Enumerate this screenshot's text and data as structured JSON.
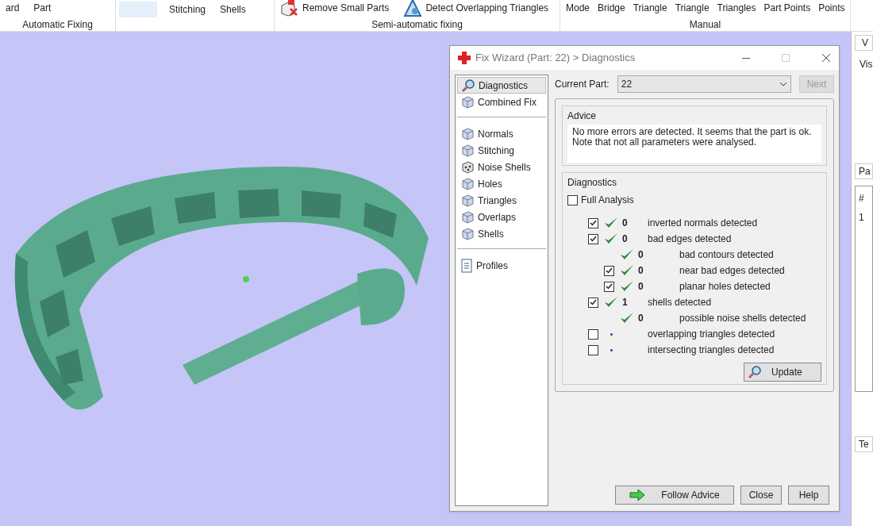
{
  "ribbon": {
    "groups": [
      {
        "label": "Automatic Fixing",
        "items": [
          {
            "text": "ard",
            "selected": false
          },
          {
            "text": "Part",
            "selected": false
          }
        ]
      },
      {
        "items": [
          {
            "selected": true
          },
          {
            "text": "Stitching",
            "selected": false
          },
          {
            "text": "Shells",
            "selected": false
          }
        ]
      },
      {
        "label": "Semi-automatic fixing",
        "items": [
          {
            "text": "Remove Small Parts",
            "selected": false
          },
          {
            "text": "Detect Overlapping Triangles",
            "selected": false
          }
        ]
      },
      {
        "label": "Manual",
        "items": [
          {
            "text": "Mode",
            "selected": false
          },
          {
            "text": "Bridge",
            "selected": false
          },
          {
            "text": "Triangle",
            "selected": false
          },
          {
            "text": "Triangle",
            "selected": false
          },
          {
            "text": "Triangles",
            "selected": false
          },
          {
            "text": "Part Points",
            "selected": false
          },
          {
            "text": "Points",
            "selected": false
          }
        ]
      }
    ]
  },
  "dialog": {
    "title": "Fix Wizard (Part: 22) > Diagnostics",
    "sidebar": {
      "groups": [
        [
          {
            "label": "Diagnostics",
            "selected": true
          },
          {
            "label": "Combined Fix",
            "selected": false
          }
        ],
        [
          {
            "label": "Normals",
            "selected": false
          },
          {
            "label": "Stitching",
            "selected": false
          },
          {
            "label": "Noise Shells",
            "selected": false
          },
          {
            "label": "Holes",
            "selected": false
          },
          {
            "label": "Triangles",
            "selected": false
          },
          {
            "label": "Overlaps",
            "selected": false
          },
          {
            "label": "Shells",
            "selected": false
          }
        ],
        [
          {
            "label": "Profiles",
            "selected": false
          }
        ]
      ]
    },
    "current_part": {
      "label": "Current Part:",
      "value": "22"
    },
    "next_button": {
      "label": "Next",
      "disabled": true
    },
    "advice": {
      "title": "Advice",
      "text": "No more errors are detected. It seems that the part is ok.\nNote that not all parameters were analysed."
    },
    "diagnostics": {
      "title": "Diagnostics",
      "full_analysis": {
        "label": "Full Analysis",
        "checked": false
      },
      "rows": [
        {
          "kind": "checkbox",
          "checked": true,
          "passed": true,
          "count": "0",
          "label": "inverted normals detected"
        },
        {
          "kind": "checkbox",
          "checked": true,
          "passed": true,
          "count": "0",
          "label": "bad edges detected",
          "children": [
            {
              "kind": "plain",
              "passed": true,
              "count": "0",
              "label": "bad contours detected"
            },
            {
              "kind": "checkbox",
              "checked": true,
              "passed": true,
              "count": "0",
              "label": "near bad edges detected"
            },
            {
              "kind": "checkbox",
              "checked": true,
              "passed": true,
              "count": "0",
              "label": "planar holes detected"
            }
          ]
        },
        {
          "kind": "checkbox",
          "checked": true,
          "passed": true,
          "count": "1",
          "label": "shells detected",
          "children": [
            {
              "kind": "plain",
              "passed": true,
              "count": "0",
              "label": "possible noise shells detected"
            }
          ]
        },
        {
          "kind": "checkbox",
          "checked": false,
          "passed": false,
          "label": "overlapping triangles detected"
        },
        {
          "kind": "checkbox",
          "checked": false,
          "passed": false,
          "label": "intersecting triangles detected"
        }
      ]
    },
    "update_button": "Update",
    "buttons": [
      "Follow Advice",
      "Close",
      "Help"
    ]
  },
  "right_panel": {
    "tabs": [
      "V",
      "Pa",
      "Te"
    ],
    "group_label": "Vis",
    "table": {
      "columns": [
        "#"
      ],
      "rows": [
        [
          "1"
        ]
      ]
    }
  }
}
